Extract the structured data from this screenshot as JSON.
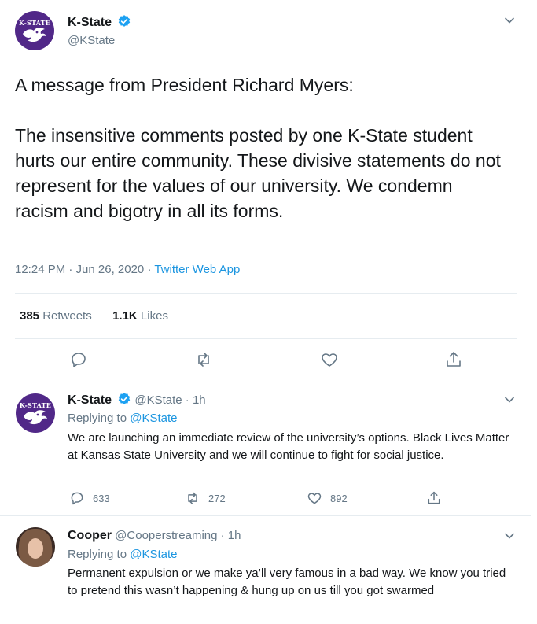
{
  "main_tweet": {
    "display_name": "K-State",
    "handle": "@KState",
    "avatar_text": "K-STATE",
    "text": "A message from President Richard Myers:\n\nThe insensitive comments posted by one K-State student hurts our entire community. These divisive statements do not represent for the values of our university. We condemn racism and bigotry in all its forms.",
    "time": "12:24 PM · Jun 26, 2020 · ",
    "source_app": "Twitter Web App",
    "retweets_count": "385",
    "retweets_label": " Retweets",
    "likes_count": "1.1K",
    "likes_label": " Likes"
  },
  "replies": [
    {
      "display_name": "K-State",
      "handle": "@KState",
      "age": " · 1h",
      "replying_prefix": "Replying to ",
      "replying_to": "@KState",
      "text": "We are launching an immediate review of the university’s options. Black Lives Matter at Kansas State University and we will continue to fight for social justice.",
      "reply_count": "633",
      "retweet_count": "272",
      "like_count": "892"
    },
    {
      "display_name": "Cooper",
      "handle": "@Cooperstreaming",
      "age": " · 1h",
      "replying_prefix": "Replying to ",
      "replying_to": "@KState",
      "text": "Permanent expulsion or we make ya’ll very famous in a bad way. We know you tried to pretend this wasn’t happening & hung up on us till you got swarmed"
    }
  ],
  "colors": {
    "brand_purple": "#512888",
    "twitter_blue": "#1b95e0",
    "muted_gray": "#657786"
  },
  "icons": [
    "verified-badge-icon",
    "chevron-down-icon",
    "reply-icon",
    "retweet-icon",
    "like-icon",
    "share-icon",
    "wildcat-logo-icon"
  ]
}
